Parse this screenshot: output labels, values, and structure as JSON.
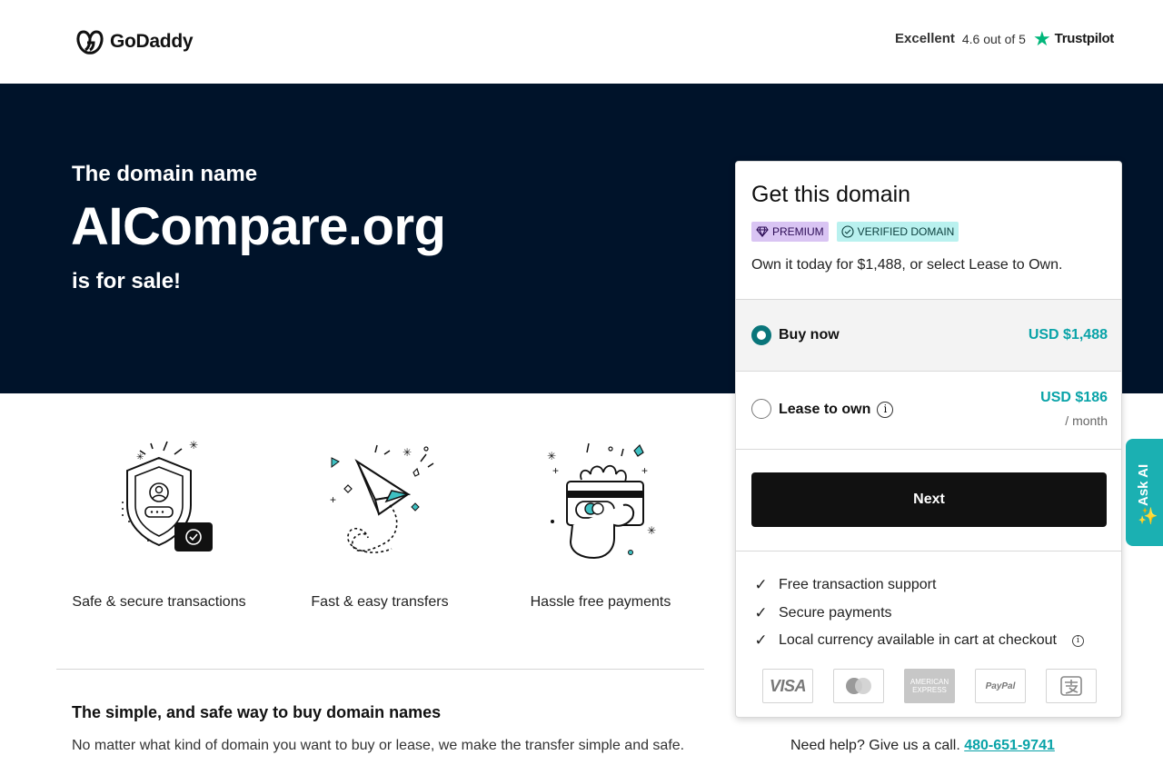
{
  "header": {
    "logo_text": "GoDaddy",
    "trustpilot": {
      "label": "Excellent",
      "rating": "4.6 out of 5",
      "brand": "Trustpilot",
      "star_color": "#00b67a"
    }
  },
  "hero": {
    "subtitle": "The domain name",
    "domain": "AICompare.org",
    "for_sale": "is for sale!",
    "background": "#00132a"
  },
  "features": [
    {
      "label": "Safe & secure transactions",
      "icon": "shield-user-icon"
    },
    {
      "label": "Fast & easy transfers",
      "icon": "paper-plane-icon"
    },
    {
      "label": "Hassle free payments",
      "icon": "hand-card-icon"
    }
  ],
  "info": {
    "title": "The simple, and safe way to buy domain names",
    "text": "No matter what kind of domain you want to buy or lease, we make the transfer simple and safe."
  },
  "card": {
    "title": "Get this domain",
    "badges": {
      "premium": "PREMIUM",
      "verified": "VERIFIED DOMAIN"
    },
    "description": "Own it today for $1,488, or select Lease to Own.",
    "options": {
      "buy": {
        "label": "Buy now",
        "price": "USD $1,488",
        "selected": true
      },
      "lease": {
        "label": "Lease to own",
        "price": "USD $186",
        "period": "/ month",
        "selected": false
      }
    },
    "next_label": "Next",
    "benefits": [
      "Free transaction support",
      "Secure payments",
      "Local currency available in cart at checkout"
    ],
    "payment_methods": [
      "VISA",
      "Mastercard",
      "AMERICAN EXPRESS",
      "PayPal",
      "Alipay"
    ],
    "accent": "#09a3a8"
  },
  "help": {
    "text": "Need help? Give us a call.",
    "phone": "480-651-9741"
  },
  "ask_ai": {
    "label": "Ask AI"
  }
}
